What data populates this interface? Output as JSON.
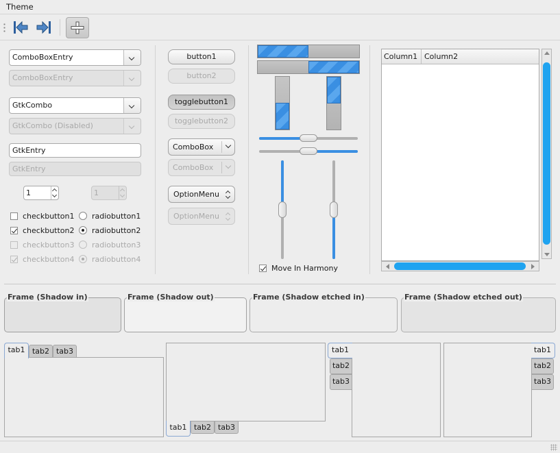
{
  "menu": {
    "theme": "Theme"
  },
  "toolbar": {
    "back_icon": "go-first-icon",
    "forward_icon": "go-last-icon",
    "add_icon": "add-icon"
  },
  "col1": {
    "comboentry1": "ComboBoxEntry",
    "comboentry2": "ComboBoxEntry",
    "gtkcombo1": "GtkCombo",
    "gtkcombo2": "GtkCombo (Disabled)",
    "entry1": "GtkEntry",
    "entry2": "GtkEntry",
    "spin1": "1",
    "spin2": "1",
    "checks": [
      {
        "label": "checkbutton1",
        "checked": false,
        "disabled": false
      },
      {
        "label": "checkbutton2",
        "checked": true,
        "disabled": false
      },
      {
        "label": "checkbutton3",
        "checked": false,
        "disabled": true
      },
      {
        "label": "checkbutton4",
        "checked": true,
        "disabled": true
      }
    ],
    "radios": [
      {
        "label": "radiobutton1",
        "checked": false,
        "disabled": false
      },
      {
        "label": "radiobutton2",
        "checked": true,
        "disabled": false
      },
      {
        "label": "radiobutton3",
        "checked": false,
        "disabled": true
      },
      {
        "label": "radiobutton4",
        "checked": true,
        "disabled": true
      }
    ]
  },
  "col2": {
    "button1": "button1",
    "button2": "button2",
    "toggle1": "togglebutton1",
    "toggle2": "togglebutton2",
    "combobox1": "ComboBox",
    "combobox2": "ComboBox",
    "option1": "OptionMenu",
    "option2": "OptionMenu"
  },
  "col3": {
    "progress": {
      "h1": 0.5,
      "h2": 0.5,
      "v1": 0.5,
      "v2": 0.5
    },
    "sliders": {
      "h1": 0.5,
      "h2": 0.5,
      "v1": 0.5,
      "v2": 0.5
    },
    "harmony_label": "Move In Harmony",
    "harmony_checked": true,
    "accent": "#3a8fe2"
  },
  "tree": {
    "columns": [
      "Column1",
      "Column2"
    ]
  },
  "frames": [
    {
      "label": "Frame (Shadow in)"
    },
    {
      "label": "Frame (Shadow out)"
    },
    {
      "label": "Frame (Shadow etched in)"
    },
    {
      "label": "Frame (Shadow etched out)"
    }
  ],
  "notebooks": [
    {
      "position": "top",
      "tabs": [
        "tab1",
        "tab2",
        "tab3"
      ],
      "active": 0
    },
    {
      "position": "bottom",
      "tabs": [
        "tab1",
        "tab2",
        "tab3"
      ],
      "active": 0
    },
    {
      "position": "left",
      "tabs": [
        "tab1",
        "tab2",
        "tab3"
      ],
      "active": 0
    },
    {
      "position": "right",
      "tabs": [
        "tab1",
        "tab2",
        "tab3"
      ],
      "active": 0
    }
  ]
}
